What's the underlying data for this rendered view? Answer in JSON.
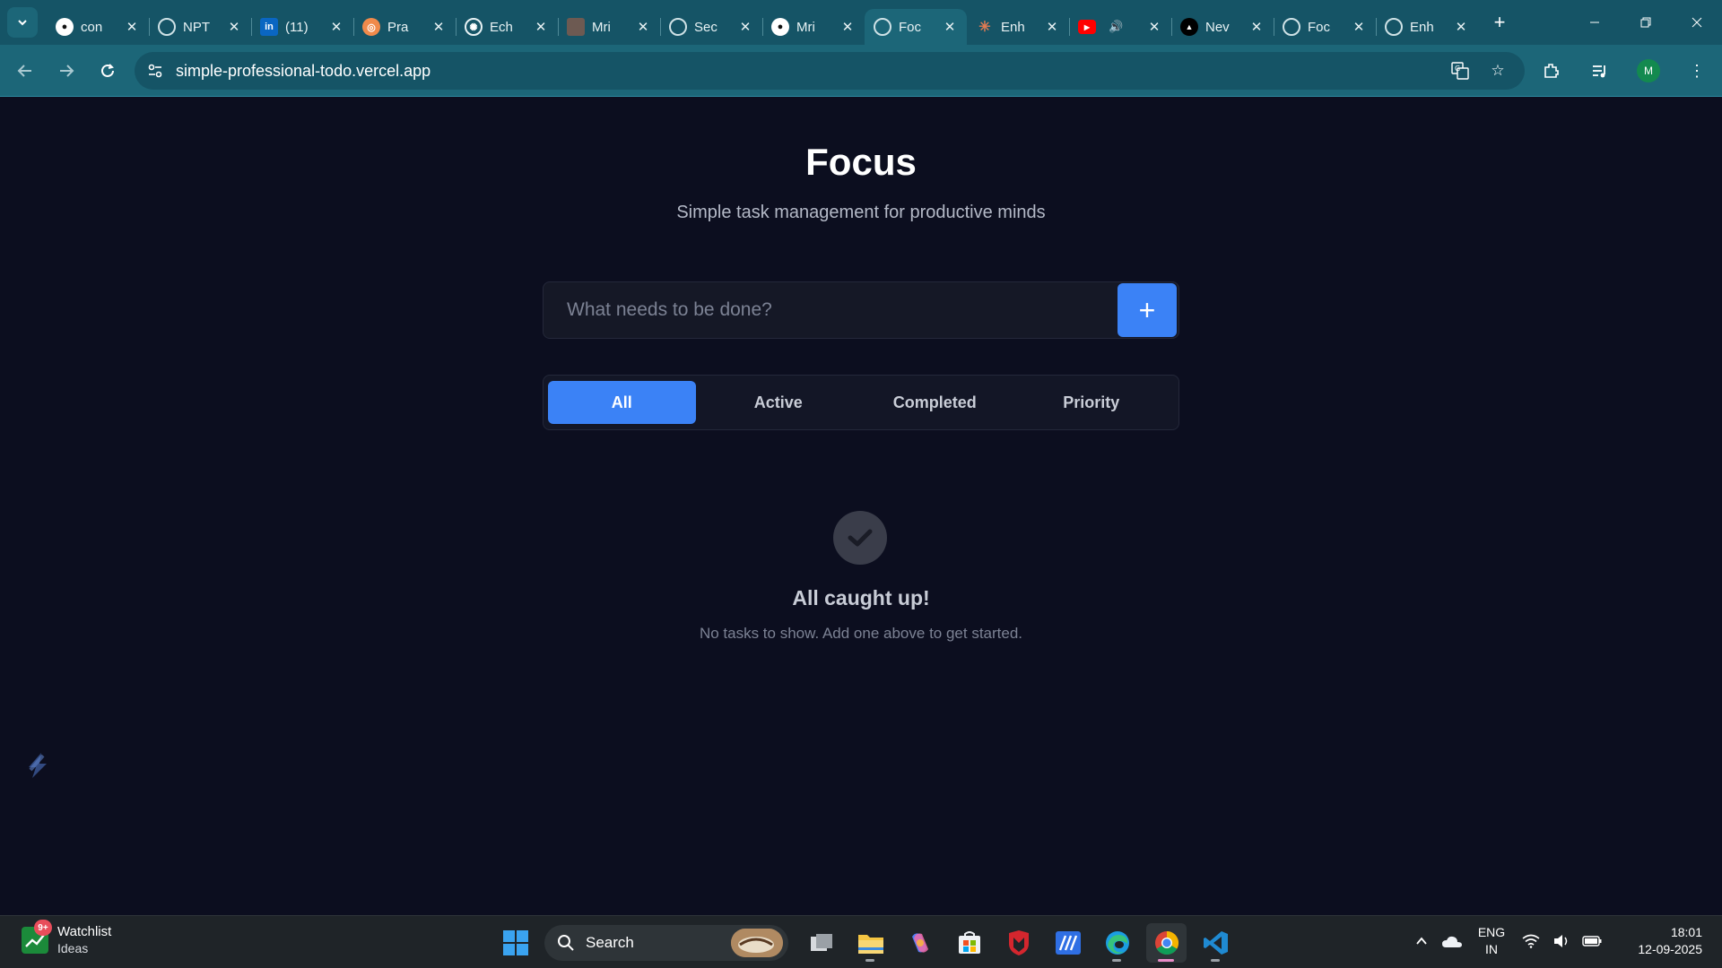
{
  "browser": {
    "tabs": [
      {
        "title": "con",
        "icon": "github-icon"
      },
      {
        "title": "NPT",
        "icon": "globe-icon"
      },
      {
        "title": "(11)",
        "icon": "linkedin-icon"
      },
      {
        "title": "Pra",
        "icon": "perplexity-icon"
      },
      {
        "title": "Ech",
        "icon": "openai-icon"
      },
      {
        "title": "Mri",
        "icon": "image-icon"
      },
      {
        "title": "Sec",
        "icon": "globe-icon"
      },
      {
        "title": "Mri",
        "icon": "github-icon"
      },
      {
        "title": "Foc",
        "icon": "globe-icon",
        "active": true
      },
      {
        "title": "Enh",
        "icon": "claude-icon"
      },
      {
        "title": "",
        "icon": "youtube-icon",
        "audio": true
      },
      {
        "title": "Nev",
        "icon": "vercel-icon"
      },
      {
        "title": "Foc",
        "icon": "globe-icon"
      },
      {
        "title": "Enh",
        "icon": "globe-icon"
      }
    ],
    "url": "simple-professional-todo.vercel.app",
    "profile_initial": "M"
  },
  "app": {
    "title": "Focus",
    "subtitle": "Simple task management for productive minds",
    "input_placeholder": "What needs to be done?",
    "add_label": "+",
    "filters": [
      {
        "label": "All",
        "active": true
      },
      {
        "label": "Active",
        "active": false
      },
      {
        "label": "Completed",
        "active": false
      },
      {
        "label": "Priority",
        "active": false
      }
    ],
    "empty_title": "All caught up!",
    "empty_subtitle": "No tasks to show. Add one above to get started.",
    "accent_color": "#3b82f6"
  },
  "taskbar": {
    "widget_badge": "9+",
    "widget_title": "Watchlist",
    "widget_subtitle": "Ideas",
    "search_label": "Search",
    "language_top": "ENG",
    "language_bottom": "IN",
    "time": "18:01",
    "date": "12-09-2025"
  }
}
